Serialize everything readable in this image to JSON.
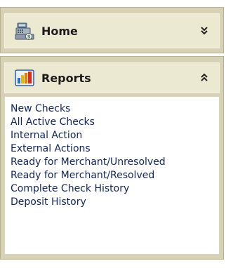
{
  "sidebar": {
    "home": {
      "label": "Home",
      "icon": "cash-register-icon",
      "state": "collapsed"
    },
    "reports": {
      "label": "Reports",
      "icon": "bar-chart-icon",
      "state": "expanded",
      "links": [
        "New Checks",
        "All Active Checks",
        "Internal Action",
        "External Actions",
        "Ready for Merchant/Unresolved",
        "Ready for Merchant/Resolved",
        "Complete Check History",
        "Deposit History"
      ]
    }
  },
  "colors": {
    "panel_border": "#d7d2b5",
    "header_bg": "#ece9d2",
    "link_text": "#10245e"
  }
}
